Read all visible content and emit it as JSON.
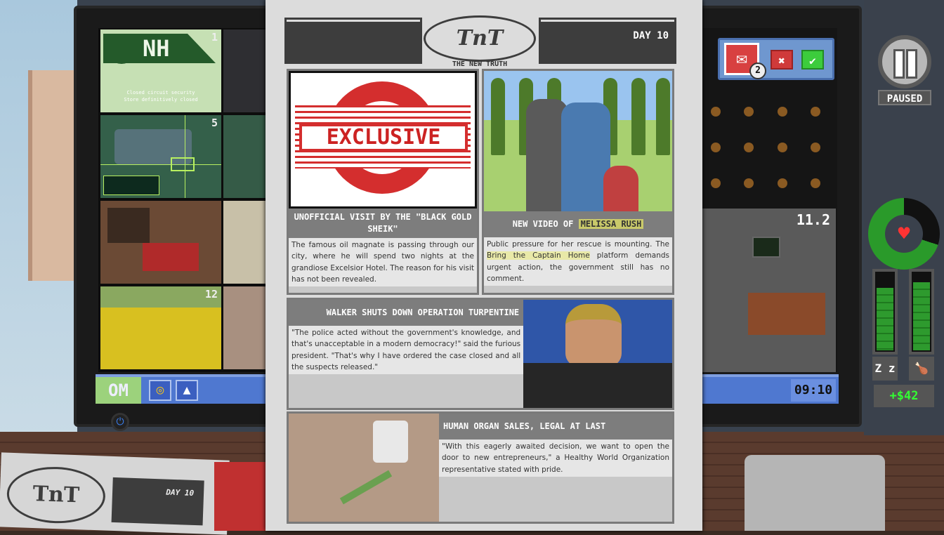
{
  "cameras": {
    "cam1": {
      "number": "1",
      "logo": "NH",
      "line1": "Closed circuit security",
      "line2": "Store definitively closed"
    },
    "cam3": {
      "number": "5"
    },
    "cam7": {
      "number": "12"
    },
    "main": {
      "number": "11.2"
    }
  },
  "taskbar": {
    "start_label": "OM",
    "clock": "09:10"
  },
  "popup": {
    "mail_count": "2",
    "reject_symbol": "✖",
    "accept_symbol": "✔"
  },
  "hud": {
    "status": "PAUSED",
    "money": "+$42",
    "health_fraction": 0.7,
    "sleep_level": 0.78,
    "food_level": 0.85,
    "sleep_icon": "Z z",
    "food_icon": "🍗"
  },
  "newspaper": {
    "logo": "TnT",
    "subtitle": "THE NEW TRUTH",
    "day": "DAY 10",
    "articles": [
      {
        "image_label": "EXCLUSIVE",
        "headline": "UNOFFICIAL VISIT BY THE \"BLACK GOLD SHEIK\"",
        "body": "The famous oil magnate is passing through our city, where he will spend two nights at the grandiose Excelsior Hotel. The reason for his visit has not been revealed."
      },
      {
        "headline_prefix": "NEW VIDEO OF ",
        "headline_highlight": "MELISSA RUSH",
        "body_prefix": "Public pressure for her rescue is mounting. The ",
        "body_highlight": "Bring the Captain Home",
        "body_suffix": " platform demands urgent action, the government still has no comment."
      },
      {
        "headline": "WALKER SHUTS DOWN OPERATION TURPENTINE",
        "body": "\"The police acted without the government's knowledge, and that's unacceptable in a modern democracy!\" said the furious president. \"That's why I have ordered the case closed and all the suspects released.\""
      },
      {
        "headline": "HUMAN ORGAN SALES, LEGAL AT LAST",
        "body": "\"With this eagerly awaited decision, we want to open the door to new entrepreneurs,\" a Healthy World Organization representative stated with pride."
      }
    ]
  },
  "desk_newspaper": {
    "logo": "TnT",
    "day": "DAY 10"
  },
  "colors": {
    "accent_red": "#d42e2e",
    "accept_green": "#3ccc3c",
    "taskbar_blue": "#4f78d0",
    "money_green": "#33ff33"
  }
}
